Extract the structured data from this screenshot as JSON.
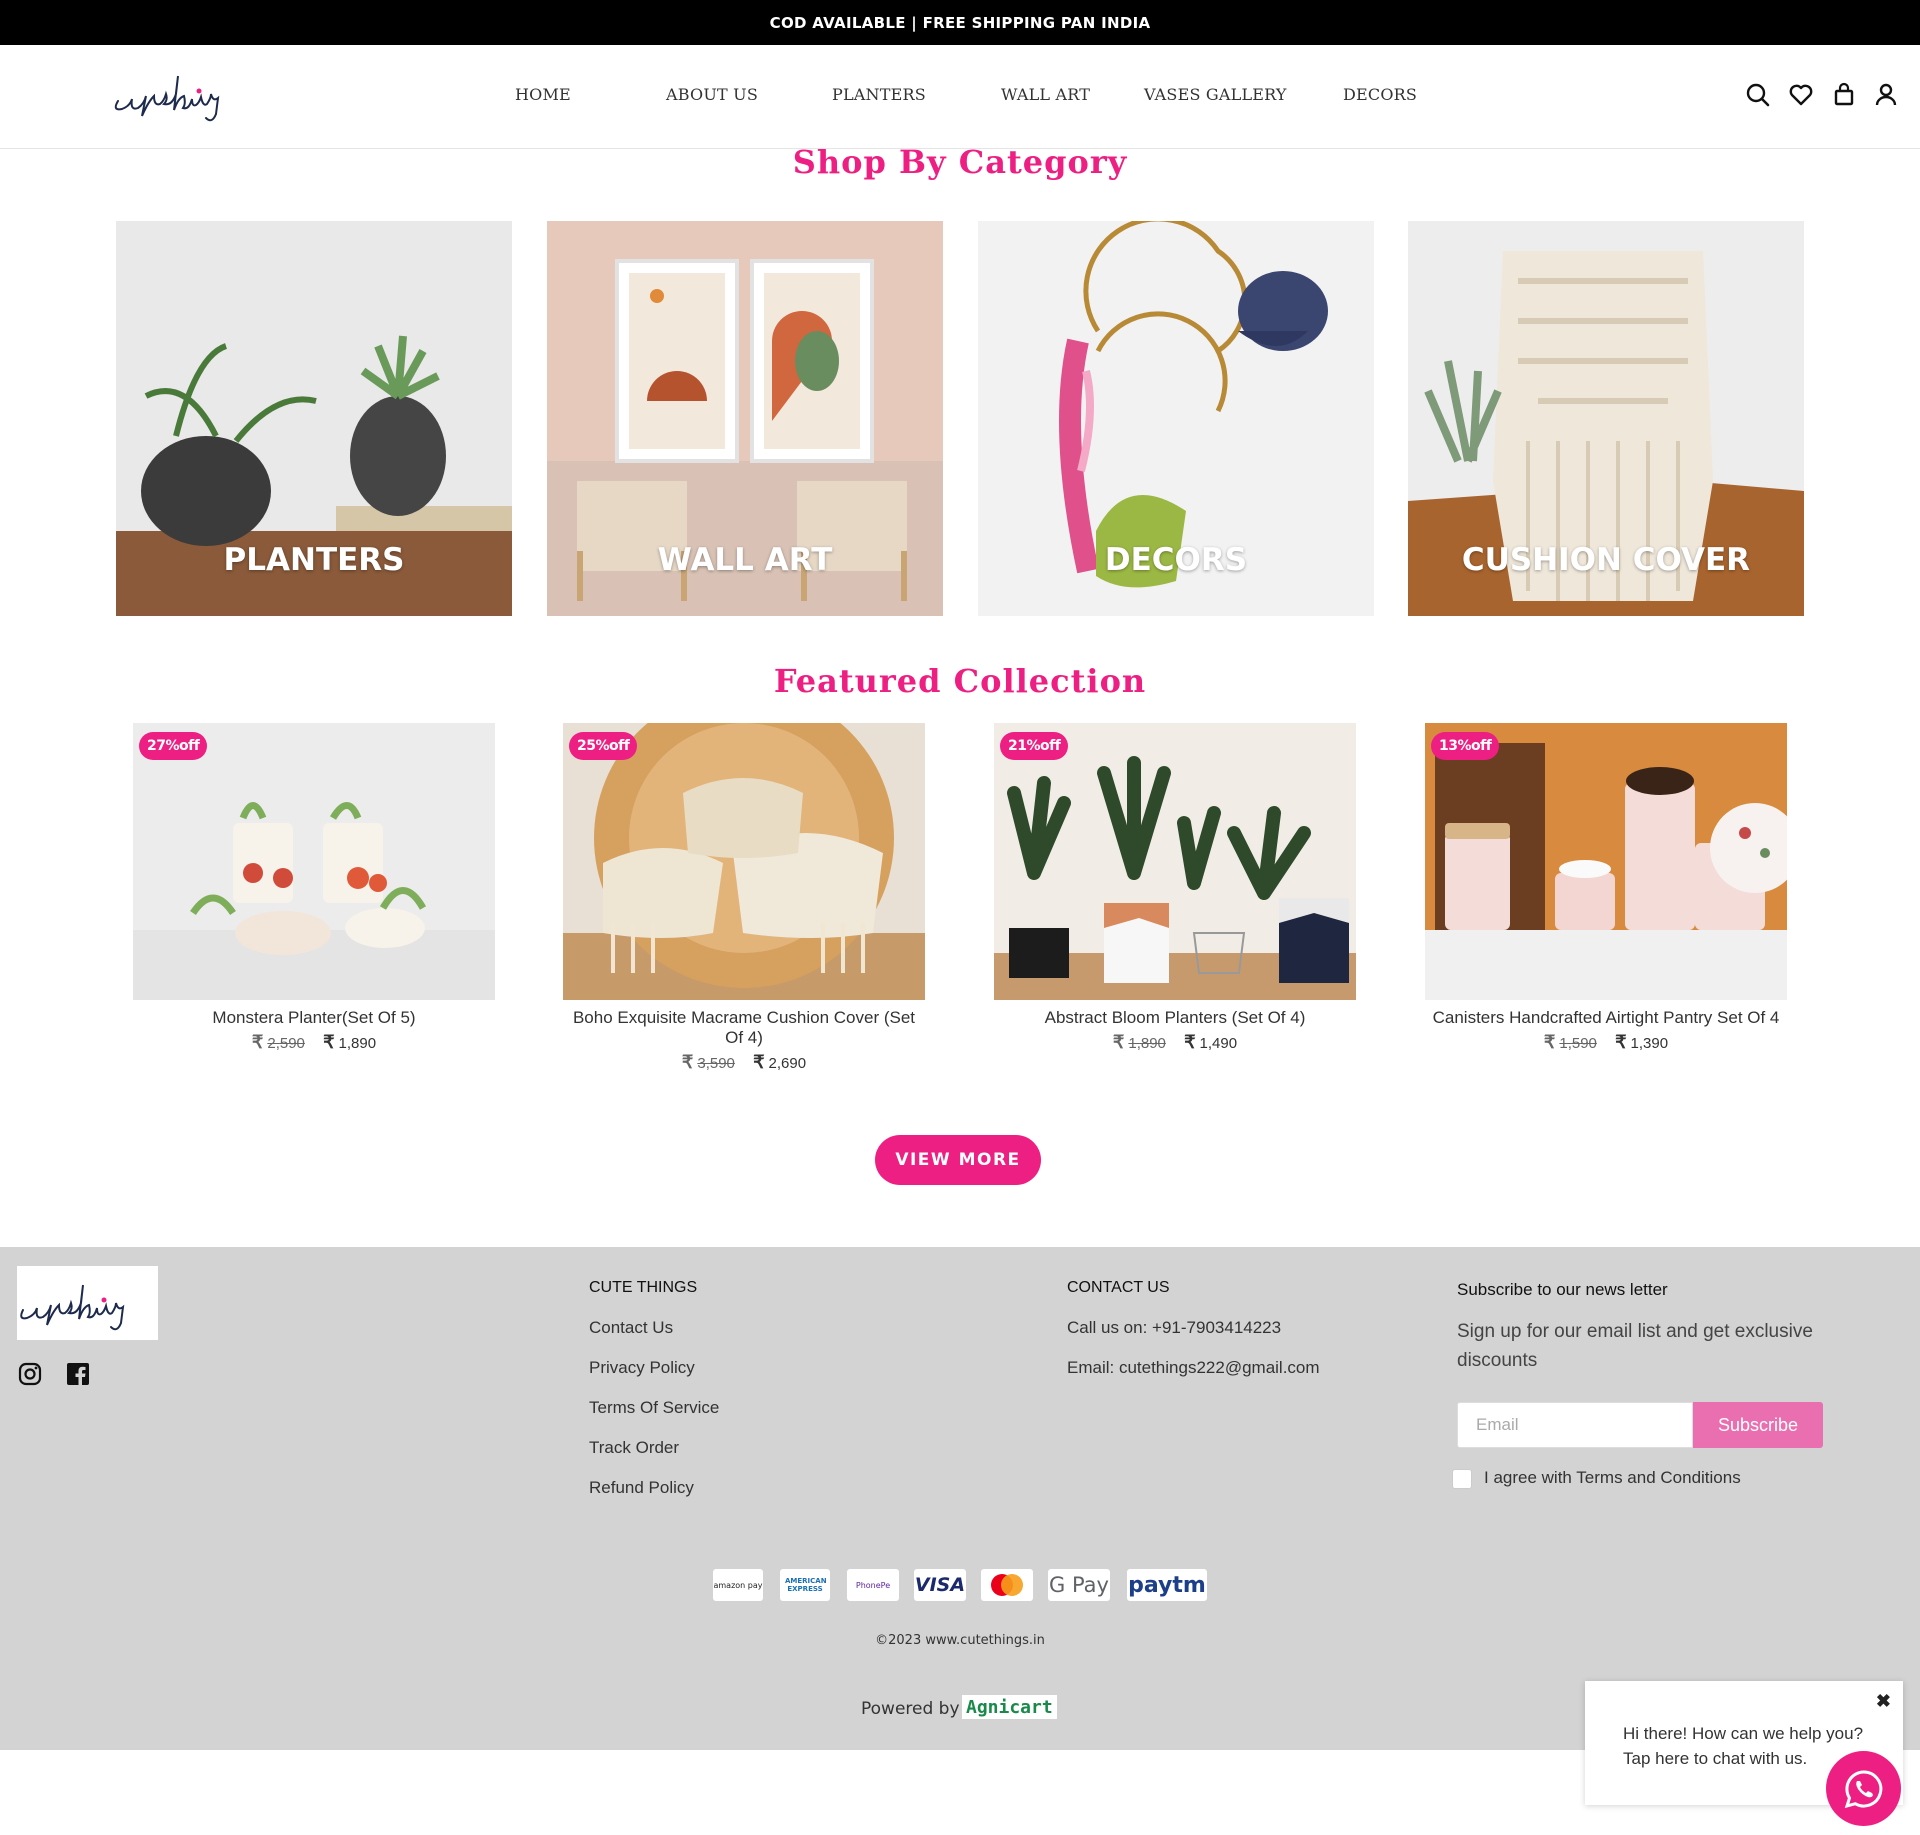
{
  "announcement": "COD AVAILABLE | FREE SHIPPING PAN INDIA",
  "brand": {
    "logo_text": "cutethings"
  },
  "nav": [
    {
      "label": "HOME"
    },
    {
      "label": "ABOUT US"
    },
    {
      "label": "PLANTERS"
    },
    {
      "label": "WALL ART"
    },
    {
      "label": "VASES GALLERY"
    },
    {
      "label": "DECORS"
    }
  ],
  "header_icons": [
    "search-icon",
    "heart-icon",
    "bag-icon",
    "user-icon"
  ],
  "shop_by_category": {
    "title": "Shop By Category",
    "items": [
      {
        "label": "PLANTERS"
      },
      {
        "label": "WALL ART"
      },
      {
        "label": "DECORS"
      },
      {
        "label": "CUSHION COVER"
      }
    ]
  },
  "featured": {
    "title": "Featured Collection",
    "products": [
      {
        "badge": "27%off",
        "name": "Monstera Planter(Set Of 5)",
        "old_price": "2,590",
        "price": "1,890"
      },
      {
        "badge": "25%off",
        "name": "Boho Exquisite Macrame Cushion Cover (Set Of 4)",
        "old_price": "3,590",
        "price": "2,690"
      },
      {
        "badge": "21%off",
        "name": "Abstract Bloom Planters (Set Of 4)",
        "old_price": "1,890",
        "price": "1,490"
      },
      {
        "badge": "13%off",
        "name": "Canisters Handcrafted Airtight Pantry Set Of 4",
        "old_price": "1,590",
        "price": "1,390"
      }
    ],
    "currency_symbol": "₹",
    "view_more": "VIEW MORE"
  },
  "footer": {
    "social": [
      "instagram-icon",
      "facebook-icon"
    ],
    "col1": {
      "title": "CUTE THINGS",
      "links": [
        "Contact Us",
        "Privacy Policy",
        "Terms Of Service",
        "Track Order",
        "Refund Policy"
      ]
    },
    "col2": {
      "title": "CONTACT US",
      "phone": "Call us on: +91-7903414223",
      "email": "Email: cutethings222@gmail.com"
    },
    "newsletter": {
      "title": "Subscribe to our news letter",
      "description": "Sign up for our email list and get exclusive discounts",
      "placeholder": "Email",
      "button": "Subscribe",
      "agree": "I agree with Terms and Conditions"
    },
    "payments": [
      "amazon pay",
      "AMERICAN EXPRESS",
      "PhonePe",
      "VISA",
      "MasterCard",
      "G Pay",
      "paytm"
    ],
    "copyright": "©2023 www.cutethings.in",
    "powered_by": "Powered by",
    "powered_brand": "Agnicart"
  },
  "chat": {
    "line1": "Hi there! How can we help you?",
    "line2": "Tap here to chat with us.",
    "close": "✖"
  },
  "colors": {
    "accent": "#ed1f83",
    "footer_bg": "#d3d3d3",
    "subscribe_btn": "#ea6fb0"
  }
}
